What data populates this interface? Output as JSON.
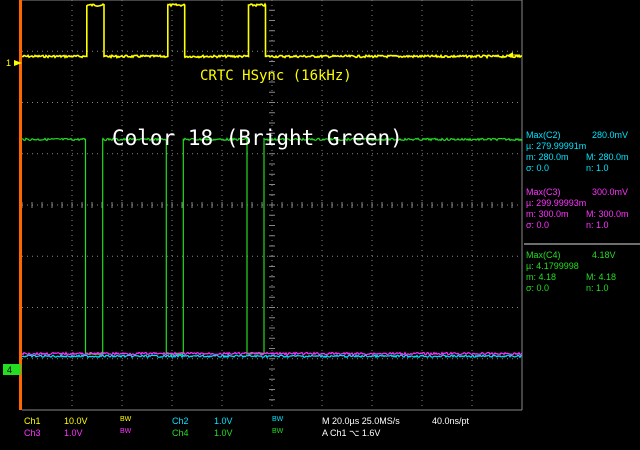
{
  "annotations": {
    "signal_label": "CRTC HSync (16kHz)",
    "title": "Color 18 (Bright Green)"
  },
  "colors": {
    "ch1": "#ffff00",
    "ch2": "#00e5ff",
    "ch3": "#ff33ff",
    "ch4": "#22dd22",
    "grid": "#888888",
    "trigger": "#ff6600"
  },
  "markers": {
    "ch1": "1",
    "ch4": "4"
  },
  "measurements": [
    {
      "head_l": "Max(C2)",
      "head_r": "280.0mV",
      "mu": "µ: 279.99991m",
      "m": "m: 280.0m",
      "M": "M: 280.0m",
      "sigma": "σ: 0.0",
      "n": "n:  1.0",
      "color": "#00e5ff"
    },
    {
      "head_l": "Max(C3)",
      "head_r": "300.0mV",
      "mu": "µ: 299.99993m",
      "m": "m: 300.0m",
      "M": "M: 300.0m",
      "sigma": "σ: 0.0",
      "n": "n:  1.0",
      "color": "#ff33ff"
    },
    {
      "head_l": "Max(C4)",
      "head_r": "4.18V",
      "mu": "µ: 4.1799998",
      "m": "m: 4.18",
      "M": "M: 4.18",
      "sigma": "σ: 0.0",
      "n": "n:  1.0",
      "color": "#22dd22"
    }
  ],
  "status": {
    "ch1": "Ch1",
    "ch1_scale": "10.0V",
    "ch1_bw": "BW",
    "ch2": "Ch2",
    "ch2_scale": "1.0V",
    "ch2_bw": "BW",
    "ch3": "Ch3",
    "ch3_scale": "1.0V",
    "ch3_bw": "BW",
    "ch4": "Ch4",
    "ch4_scale": "1.0V",
    "ch4_bw": "BW",
    "timebase": "M 20.0µs 25.0MS/s",
    "resolution": "40.0ns/pt",
    "trigger": "A  Ch1  ⌥  1.6V"
  },
  "chart_data": {
    "type": "line",
    "x_unit": "µs",
    "time_per_div": 20,
    "divisions_x": 10,
    "divisions_y": 8,
    "series": [
      {
        "name": "Ch1",
        "volts_per_div": 10,
        "level_low": 0,
        "level_high": 10,
        "offset_div": 2.9,
        "edges_us": [
          25.9,
          32.8,
          58.3,
          65.1,
          90.6,
          97.4
        ],
        "start_high": false
      },
      {
        "name": "Ch4",
        "volts_per_div": 1,
        "level_low": 0,
        "level_high": 4.18,
        "offset_div": -2.9,
        "edges_us": [
          25.4,
          32.3,
          57.7,
          64.5,
          90.0,
          96.8
        ],
        "start_high": true
      },
      {
        "name": "Ch2",
        "volts_per_div": 1,
        "level_low": 0,
        "level_high": 0.28,
        "offset_div": -2.95,
        "edges_us": [],
        "start_high": false
      },
      {
        "name": "Ch3",
        "volts_per_div": 1,
        "level_low": 0,
        "level_high": 0.3,
        "offset_div": -2.9,
        "edges_us": [],
        "start_high": false
      }
    ]
  }
}
